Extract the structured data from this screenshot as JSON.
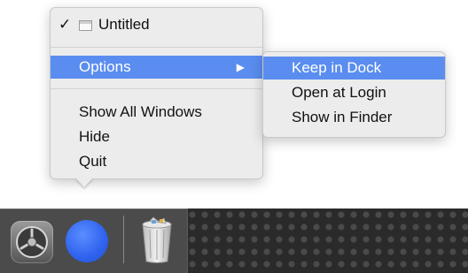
{
  "menu": {
    "window_item": {
      "checkmark": "✓",
      "label": "Untitled",
      "icon": "window-icon"
    },
    "options": {
      "label": "Options",
      "arrow": "▶"
    },
    "show_all_windows": "Show All Windows",
    "hide": "Hide",
    "quit": "Quit"
  },
  "submenu": {
    "keep_in_dock": "Keep in Dock",
    "open_at_login": "Open at Login",
    "show_in_finder": "Show in Finder"
  },
  "dock": {
    "apps": [
      {
        "name": "System Preferences",
        "icon": "system-preferences-icon"
      },
      {
        "name": "App",
        "icon": "blue-circle-app-icon"
      },
      {
        "name": "Trash",
        "icon": "trash-icon"
      }
    ]
  },
  "colors": {
    "highlight": "#5a8def",
    "menu_bg": "#ececec",
    "dock_bg": "#2a2a2a",
    "app_blue": "#2f62ee"
  }
}
